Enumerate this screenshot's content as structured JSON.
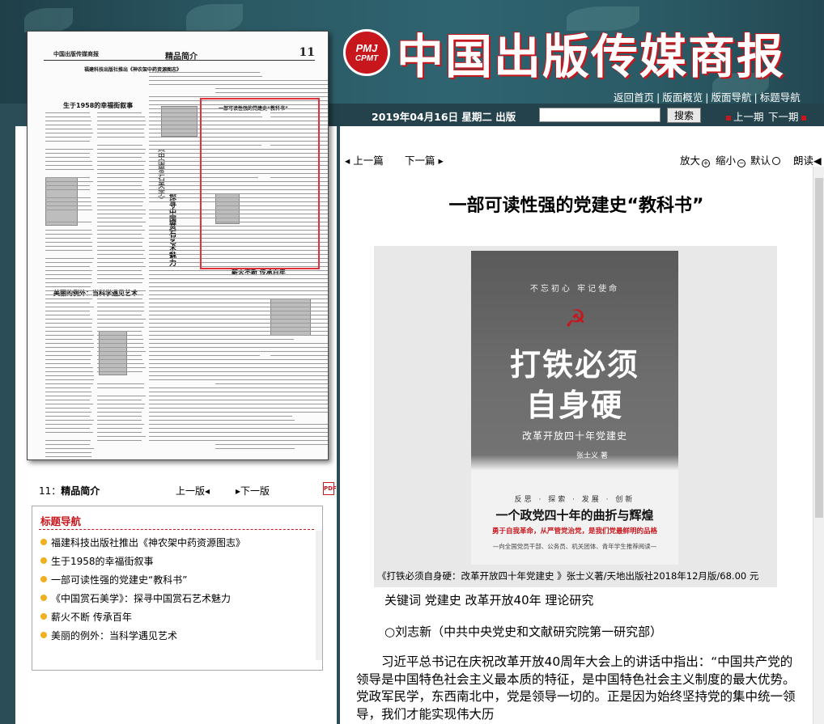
{
  "header": {
    "logo_badge_top": "PMJ",
    "logo_badge_bottom": "CPMT",
    "site_title": "中国出版传媒商报",
    "nav": [
      "返回首页",
      "版面概览",
      "版面导航",
      "标题导航"
    ],
    "date": "2019年04月16日 星期二 出版",
    "search_placeholder": "",
    "search_button": "搜索",
    "prev_issue": "上一期",
    "next_issue": "下一期"
  },
  "thumbnail": {
    "paper_name": "中国出版传媒商报",
    "section": "精品简介",
    "page_number": "11",
    "headlines": [
      "福建科技出版社推出《神农架中药资源图志》",
      "生于1958的幸福街叙事",
      "一部可读性强的党建史“教科书”",
      "《中国赏石美学》",
      "探寻中国赏石艺术魅力",
      "薪火不断 传承百年",
      "美丽的例外：当科学遇见艺术"
    ]
  },
  "page_nav": {
    "current_page_num": "11：",
    "current_page_name": "精品简介",
    "prev_page": "上一版",
    "next_page": "下一版",
    "pdf_icon_label": "PDF"
  },
  "toc": {
    "title": "标题导航",
    "items": [
      "福建科技出版社推出《神农架中药资源图志》",
      "生于1958的幸福街叙事",
      "一部可读性强的党建史“教科书”",
      "《中国赏石美学》：探寻中国赏石艺术魅力",
      "薪火不断 传承百年",
      "美丽的例外：当科学遇见艺术"
    ]
  },
  "article_tools": {
    "prev": "上一篇",
    "next": "下一篇",
    "zoom_in": "放大",
    "zoom_out": "缩小",
    "default": "默认",
    "read": "朗读"
  },
  "article": {
    "title": "一部可读性强的党建史“教科书”",
    "book_cover": {
      "tagline": "不忘初心 牢记使命",
      "main_line1": "打铁必须",
      "main_line2": "自身硬",
      "subtitle": "改革开放四十年党建史",
      "author": "张士义 著",
      "keywords": "反思 · 探索 · 发展 · 创新",
      "slogan": "一个政党四十年的曲折与辉煌",
      "slogan2": "勇于自我革命，从严管党治党，是我们党最鲜明的品格",
      "slogan3": "—向全国党员干部、公务员、机关团体、青年学生推荐阅读—"
    },
    "caption": "《打铁必须自身硬：改革开放四十年党建史 》张士义著/天地出版社2018年12月版/68.00 元",
    "keywords": "关键词 党建史 改革开放40年 理论研究",
    "author_line": "○刘志新（中共中央党史和文献研究院第一研究部）",
    "body": "习近平总书记在庆祝改革开放40周年大会上的讲话中指出：“中国共产党的领导是中国特色社会主义最本质的特征，是中国特色社会主义制度的最大优势。党政军民学，东西南北中，党是领导一切的。正是因为始终坚持党的集中统一领导，我们才能实现伟大历"
  },
  "colors": {
    "accent_red": "#c8161d",
    "header_teal": "#2a4d57",
    "bullet_gold": "#f0b020"
  }
}
